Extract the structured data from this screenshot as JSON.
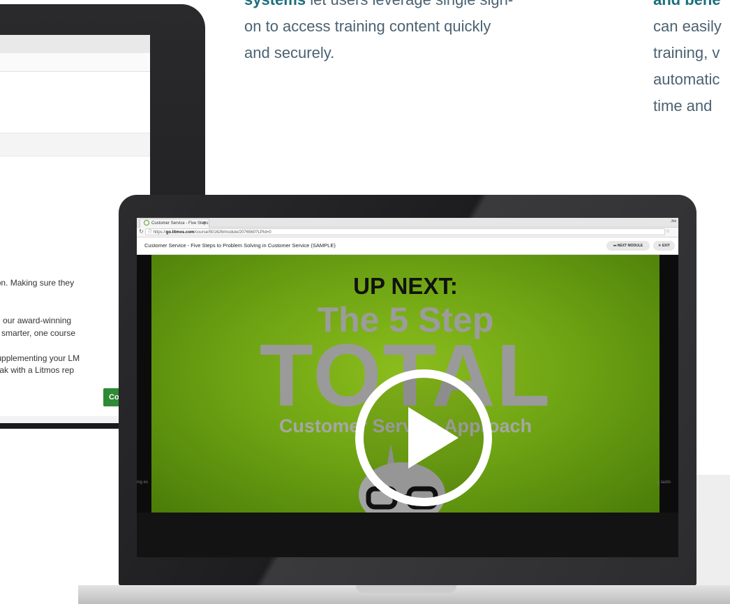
{
  "background_laptop": {
    "lines": [
      "anization. Making sure they",
      "ge from our award-winning",
      "to work smarter, one course",
      "ed in supplementing your LM",
      "t to speak with a Litmos rep"
    ],
    "button_label": "Co"
  },
  "marketing": {
    "col1": {
      "bold": "systems",
      "line1_rest": " let users leverage single sign-",
      "line2": "on to access training content quickly",
      "line3": "and securely."
    },
    "col2": {
      "bold": "and bene",
      "line2": "can easily",
      "line3": "training, v",
      "line4": "automatic",
      "line5": "time and"
    }
  },
  "browser": {
    "tab_title": "Customer Service - Five Steps",
    "tab_close": "×",
    "user": "Jos",
    "url_scheme": "https://",
    "url_host": "go.litmos.com",
    "url_path": "/course/501626/module/2076560?LPId=0"
  },
  "course": {
    "title": "Customer Service - Five Steps to Problem Solving in Customer Service (SAMPLE)",
    "next_module_label": "⏭ NEXT MODULE",
    "exit_label": "✕ EXIT"
  },
  "video": {
    "up_next": "UP NEXT:",
    "step": "The 5 Step",
    "total": "TOTAL",
    "approach": "Customer Service Approach",
    "left_caption": "ing es",
    "right_caption": "g lastin"
  },
  "colors": {
    "accent_teal": "#1b6f7d",
    "body_text": "#4b6272",
    "video_green": "#6fa514",
    "button_green": "#2f8a35"
  },
  "icons": [
    "reload-icon",
    "info-icon",
    "star-icon",
    "play-icon",
    "mascot-icon"
  ]
}
